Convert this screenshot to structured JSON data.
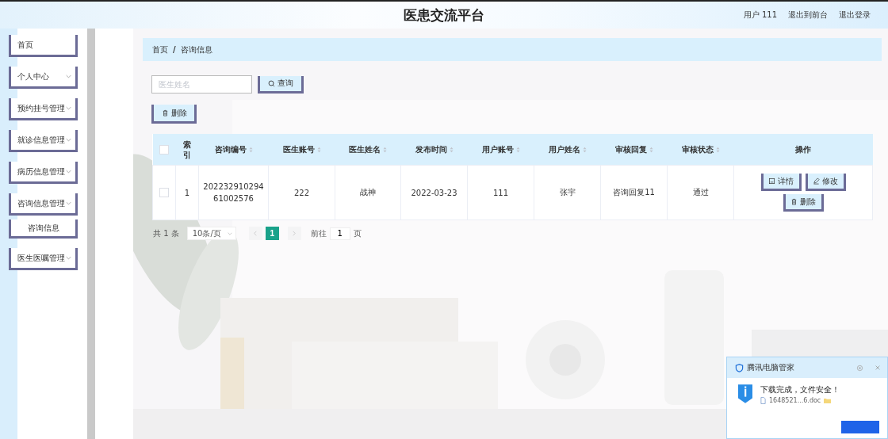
{
  "header": {
    "title": "医患交流平台",
    "links": [
      "用户 111",
      "退出到前台",
      "退出登录"
    ]
  },
  "sidebar": {
    "items": [
      {
        "label": "首页",
        "kind": "link"
      },
      {
        "label": "个人中心",
        "kind": "group"
      },
      {
        "label": "预约挂号管理",
        "kind": "group"
      },
      {
        "label": "就诊信息管理",
        "kind": "group"
      },
      {
        "label": "病历信息管理",
        "kind": "group"
      },
      {
        "label": "咨询信息管理",
        "kind": "group",
        "children": [
          {
            "label": "咨询信息"
          }
        ]
      },
      {
        "label": "医生医嘱管理",
        "kind": "group"
      }
    ]
  },
  "breadcrumb": {
    "items": [
      "首页",
      "咨询信息"
    ],
    "separator": "/"
  },
  "search": {
    "placeholder": "医生姓名",
    "button": "查询"
  },
  "toolbar": {
    "delete_button": "删除"
  },
  "table": {
    "select_all": {
      "checked": false
    },
    "columns": [
      {
        "label": "索引",
        "sortable": false
      },
      {
        "label": "咨询编号",
        "sortable": true
      },
      {
        "label": "医生账号",
        "sortable": true
      },
      {
        "label": "医生姓名",
        "sortable": true
      },
      {
        "label": "发布时间",
        "sortable": true
      },
      {
        "label": "用户账号",
        "sortable": true
      },
      {
        "label": "用户姓名",
        "sortable": true
      },
      {
        "label": "审核回复",
        "sortable": true
      },
      {
        "label": "审核状态",
        "sortable": true
      },
      {
        "label": "操作",
        "sortable": false
      }
    ],
    "rows": [
      {
        "checked": false,
        "cells": [
          "1",
          "20223291029461002576",
          "222",
          "战神",
          "2022-03-23",
          "111",
          "张宇",
          "咨询回复11",
          "通过"
        ],
        "actions": [
          {
            "label": "详情",
            "kind": "detail"
          },
          {
            "label": "修改",
            "kind": "edit"
          },
          {
            "label": "删除",
            "kind": "delete"
          }
        ]
      }
    ]
  },
  "pagination": {
    "total": "共 1 条",
    "page_size": "10条/页",
    "pages": [
      {
        "label": "1",
        "selected": true
      }
    ],
    "goto_label": "前往",
    "goto_value": "1",
    "goto_suffix": "页"
  },
  "notification": {
    "title": "腾讯电脑管家",
    "message": "下载完成，文件安全！",
    "file": "1648521...6.doc"
  }
}
